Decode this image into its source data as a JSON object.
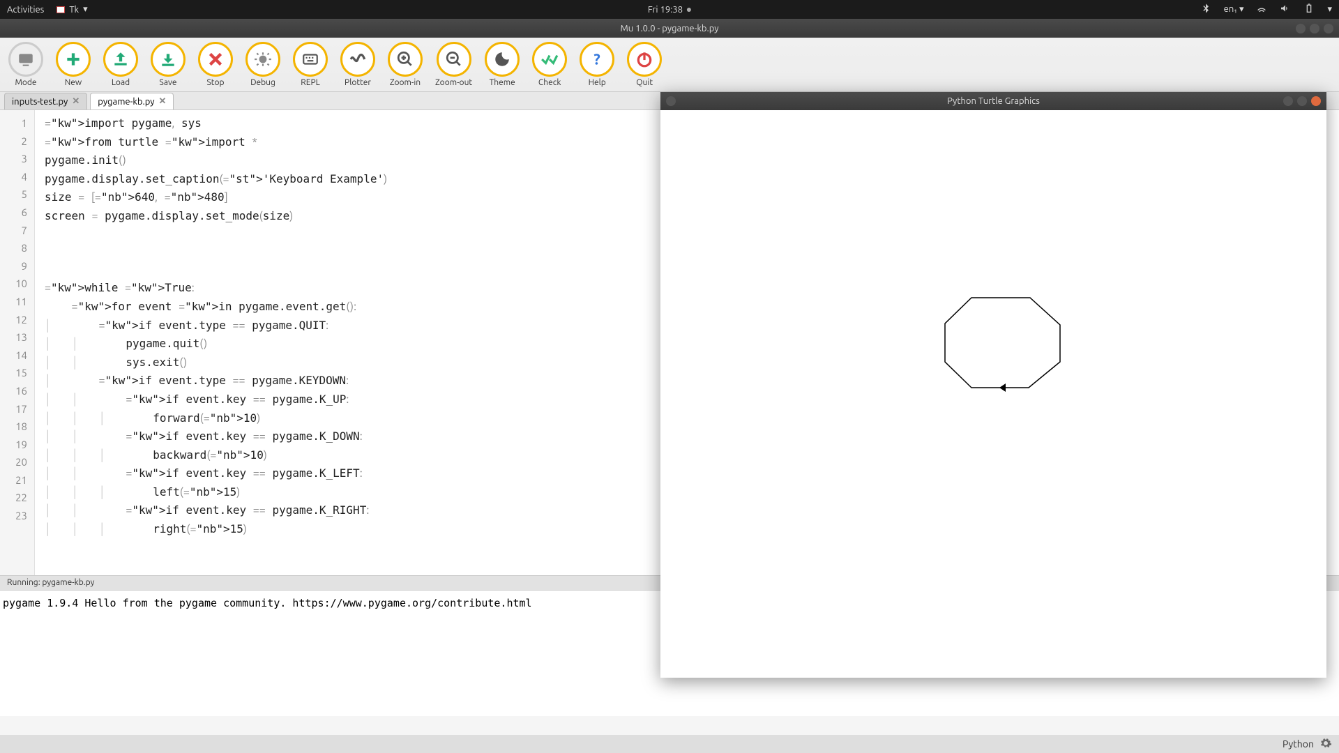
{
  "topbar": {
    "activities": "Activities",
    "app": "Tk",
    "clock": "Fri 19:38",
    "lang": "en₁"
  },
  "titlebar": {
    "title": "Mu 1.0.0 - pygame-kb.py"
  },
  "toolbar": [
    {
      "id": "mode",
      "label": "Mode"
    },
    {
      "id": "new",
      "label": "New"
    },
    {
      "id": "load",
      "label": "Load"
    },
    {
      "id": "save",
      "label": "Save"
    },
    {
      "id": "stop",
      "label": "Stop"
    },
    {
      "id": "debug",
      "label": "Debug"
    },
    {
      "id": "repl",
      "label": "REPL"
    },
    {
      "id": "plotter",
      "label": "Plotter"
    },
    {
      "id": "zoom-in",
      "label": "Zoom-in"
    },
    {
      "id": "zoom-out",
      "label": "Zoom-out"
    },
    {
      "id": "theme",
      "label": "Theme"
    },
    {
      "id": "check",
      "label": "Check"
    },
    {
      "id": "help",
      "label": "Help"
    },
    {
      "id": "quit",
      "label": "Quit"
    }
  ],
  "tabs": [
    {
      "label": "inputs-test.py",
      "active": false
    },
    {
      "label": "pygame-kb.py",
      "active": true
    }
  ],
  "code": {
    "lines": [
      "import pygame, sys",
      "from turtle import *",
      "pygame.init()",
      "pygame.display.set_caption('Keyboard Example')",
      "size = [640, 480]",
      "screen = pygame.display.set_mode(size)",
      "",
      "",
      "",
      "while True:",
      "    for event in pygame.event.get():",
      "        if event.type == pygame.QUIT:",
      "            pygame.quit()",
      "            sys.exit()",
      "        if event.type == pygame.KEYDOWN:",
      "            if event.key == pygame.K_UP:",
      "                forward(10)",
      "            if event.key == pygame.K_DOWN:",
      "                backward(10)",
      "            if event.key == pygame.K_LEFT:",
      "                left(15)",
      "            if event.key == pygame.K_RIGHT:",
      "                right(15)"
    ]
  },
  "runbar": "Running: pygame-kb.py",
  "console": [
    "pygame 1.9.4",
    "Hello from the pygame community. https://www.pygame.org/contribute.html"
  ],
  "statusbar": {
    "lang": "Python"
  },
  "turtle": {
    "title": "Python Turtle Graphics"
  }
}
